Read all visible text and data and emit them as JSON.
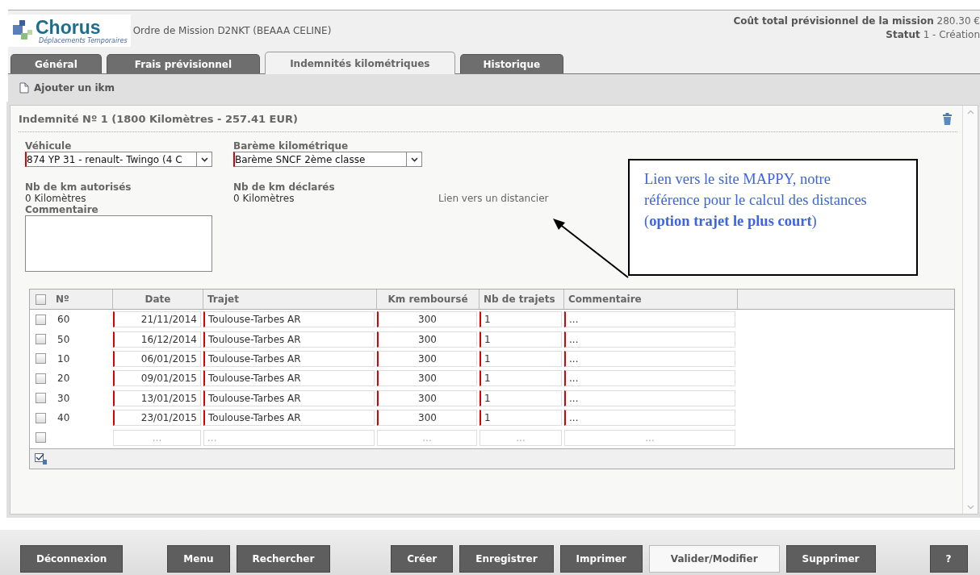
{
  "header": {
    "logo_text": "Chorus",
    "logo_subtitle": "Déplacements Temporaires",
    "title": "Ordre de Mission D2NKT (BEAAA CELINE)",
    "cost_label": "Coût total prévisionnel de la mission",
    "cost_value": "280.30 €",
    "status_label": "Statut",
    "status_value": "1 - Création"
  },
  "tabs": [
    {
      "label": "Général",
      "selected": false
    },
    {
      "label": "Frais prévisionnel",
      "selected": false
    },
    {
      "label": "Indemnités kilométriques",
      "selected": true
    },
    {
      "label": "Historique",
      "selected": false
    }
  ],
  "toolbar": {
    "add_label": "Ajouter un ikm"
  },
  "indemnity": {
    "title": "Indemnité Nº 1 (1800 Kilomètres - 257.41 EUR)",
    "vehicle": {
      "label": "Véhicule",
      "value": "874 YP 31 - renault- Twingo (4 C"
    },
    "scale": {
      "label": "Barème kilométrique",
      "value": "Barème SNCF 2ème classe"
    },
    "km_authorized": {
      "label": "Nb de km autorisés",
      "value": "0 Kilomètres"
    },
    "km_declared": {
      "label": "Nb de km déclarés",
      "value": "0 Kilomètres"
    },
    "distance_link": "Lien vers un distancier",
    "comment_label": "Commentaire"
  },
  "table": {
    "all_checked": false,
    "columns": [
      "Nº",
      "Date",
      "Trajet",
      "Km remboursé",
      "Nb de trajets",
      "Commentaire"
    ],
    "rows": [
      {
        "kind": "entry",
        "checked": false,
        "cells": [
          "60",
          "21/11/2014",
          "Toulouse-Tarbes AR",
          "300",
          "1",
          "..."
        ]
      },
      {
        "kind": "entry",
        "checked": false,
        "cells": [
          "50",
          "16/12/2014",
          "Toulouse-Tarbes AR",
          "300",
          "1",
          "..."
        ]
      },
      {
        "kind": "entry",
        "checked": false,
        "cells": [
          "10",
          "06/01/2015",
          "Toulouse-Tarbes AR",
          "300",
          "1",
          "..."
        ]
      },
      {
        "kind": "entry",
        "checked": false,
        "cells": [
          "20",
          "09/01/2015",
          "Toulouse-Tarbes AR",
          "300",
          "1",
          "..."
        ]
      },
      {
        "kind": "entry",
        "checked": false,
        "cells": [
          "30",
          "13/01/2015",
          "Toulouse-Tarbes AR",
          "300",
          "1",
          "..."
        ]
      },
      {
        "kind": "entry",
        "checked": false,
        "cells": [
          "40",
          "23/01/2015",
          "Toulouse-Tarbes AR",
          "300",
          "1",
          "..."
        ]
      },
      {
        "kind": "new",
        "checked": false,
        "cells": [
          "",
          "...",
          "...",
          "...",
          "...",
          "..."
        ]
      }
    ]
  },
  "callout": "Lien vers le site MAPPY, notre référence pour le calcul des distances (**option trajet le plus court**)",
  "button_groups": [
    [
      {
        "label": "Déconnexion",
        "selected": false
      }
    ],
    [
      {
        "label": "Menu",
        "selected": false
      },
      {
        "label": "Rechercher",
        "selected": false
      }
    ],
    [
      {
        "label": "Créer",
        "selected": false
      },
      {
        "label": "Enregistrer",
        "selected": false
      },
      {
        "label": "Imprimer",
        "selected": false
      },
      {
        "label": "Valider/Modifier",
        "selected": true
      },
      {
        "label": "Supprimer",
        "selected": false
      }
    ],
    [
      {
        "label": "?",
        "selected": false
      }
    ]
  ]
}
